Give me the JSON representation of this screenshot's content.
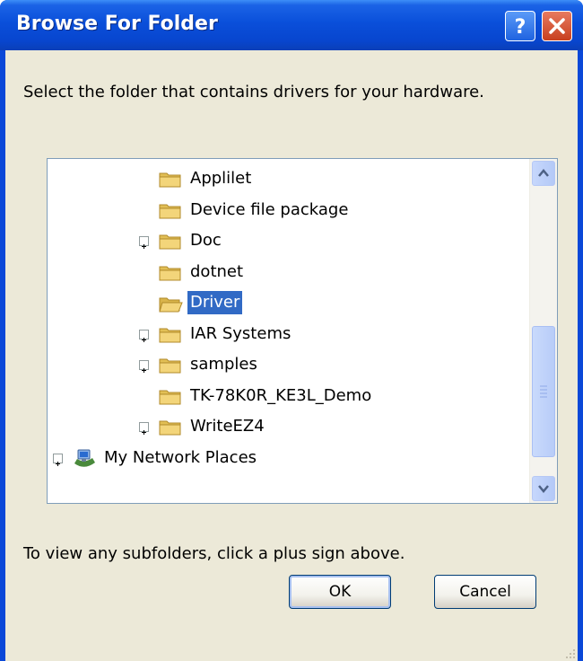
{
  "window": {
    "title": "Browse For Folder",
    "help_glyph": "?",
    "close_glyph": "×"
  },
  "dialog": {
    "instruction": "Select the folder that contains drivers for your hardware.",
    "hint": "To view any subfolders, click a plus sign above.",
    "ok_label": "OK",
    "cancel_label": "Cancel"
  },
  "tree": {
    "items": [
      {
        "label": "Applilet",
        "expandable": false,
        "selected": false,
        "icon": "folder-icon"
      },
      {
        "label": "Device file package",
        "expandable": false,
        "selected": false,
        "icon": "folder-icon"
      },
      {
        "label": "Doc",
        "expandable": true,
        "selected": false,
        "icon": "folder-icon"
      },
      {
        "label": "dotnet",
        "expandable": false,
        "selected": false,
        "icon": "folder-icon"
      },
      {
        "label": "Driver",
        "expandable": false,
        "selected": true,
        "icon": "open-folder-icon"
      },
      {
        "label": "IAR Systems",
        "expandable": true,
        "selected": false,
        "icon": "folder-icon"
      },
      {
        "label": "samples",
        "expandable": true,
        "selected": false,
        "icon": "folder-icon"
      },
      {
        "label": "TK-78K0R_KE3L_Demo",
        "expandable": false,
        "selected": false,
        "icon": "folder-icon"
      },
      {
        "label": "WriteEZ4",
        "expandable": true,
        "selected": false,
        "icon": "folder-icon"
      },
      {
        "label": "My Network Places",
        "expandable": true,
        "selected": false,
        "icon": "network-places-icon"
      }
    ]
  },
  "colors": {
    "titlebar": "#0a4fda",
    "selection": "#316ac5",
    "dialog_bg": "#ece9d8",
    "folder": "#f3d57a"
  }
}
